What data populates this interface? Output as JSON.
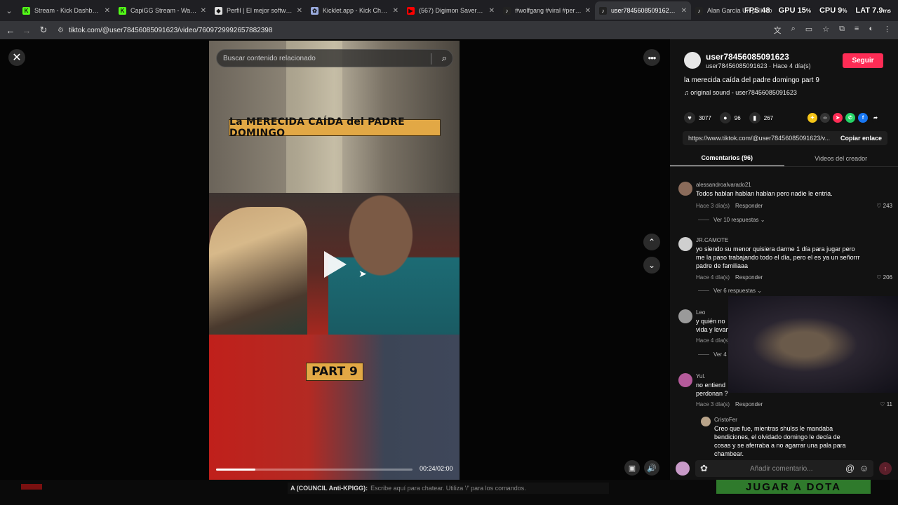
{
  "browser": {
    "tabs": [
      {
        "title": "Stream - Kick Dashboard",
        "fav": "K",
        "color": "#53fc18"
      },
      {
        "title": "CapiGG Stream - Watch Li",
        "fav": "K",
        "color": "#53fc18"
      },
      {
        "title": "Perfil | El mejor software p",
        "fav": "◆",
        "color": "#dddddd"
      },
      {
        "title": "Kicklet.app - Kick Chatbot",
        "fav": "✿",
        "color": "#9ad"
      },
      {
        "title": "(567) Digimon Savers - Bre",
        "fav": "▶",
        "color": "#ff0000"
      },
      {
        "title": "#wolfgang #viral #peru #",
        "fav": "♪",
        "color": "#222"
      },
      {
        "title": "user78456085091623 (@us",
        "fav": "♪",
        "color": "#222",
        "active": true
      },
      {
        "title": "Alan García Un político",
        "fav": "♪",
        "color": "#222"
      }
    ],
    "url": "tiktok.com/@user78456085091623/video/7609729992657882398"
  },
  "overlay": {
    "fps_label": "FPS",
    "fps_value": "48",
    "gpu_label": "GPU",
    "gpu_value": "15",
    "gpu_unit": "%",
    "cpu_label": "CPU",
    "cpu_value": "9",
    "cpu_unit": "%",
    "lat_label": "LAT",
    "lat_value": "7.9",
    "lat_unit": "ms"
  },
  "video": {
    "search_placeholder": "Buscar contenido relacionado",
    "caption_title": "La MERECIDA CAÍDA del PADRE DOMINGO",
    "caption_part": "PART 9",
    "time": "00:24/02:00",
    "progress": 0.2
  },
  "author": {
    "username": "user78456085091623",
    "subline": "user78456085091623 · Hace 4 día(s)",
    "follow_label": "Seguir",
    "description": "la merecida caída del padre domingo part 9",
    "sound": "original sound - user78456085091623"
  },
  "stats": {
    "likes": "3077",
    "comments": "96",
    "saves": "267"
  },
  "share": {
    "link": "https://www.tiktok.com/@user78456085091623/v...",
    "copy_label": "Copiar enlace",
    "icons": [
      {
        "name": "repost-icon",
        "glyph": "✦",
        "color": "#f5c518"
      },
      {
        "name": "embed-icon",
        "glyph": "‹›",
        "color": "#333"
      },
      {
        "name": "send-to-friends-icon",
        "glyph": "➤",
        "color": "#fe2c55"
      },
      {
        "name": "whatsapp-icon",
        "glyph": "✆",
        "color": "#25d366"
      },
      {
        "name": "facebook-icon",
        "glyph": "f",
        "color": "#1877f2"
      },
      {
        "name": "share-arrow-icon",
        "glyph": "➦",
        "color": "#121212"
      }
    ]
  },
  "panel_tabs": {
    "comments": "Comentarios (96)",
    "creator_videos": "Videos del creador"
  },
  "comments": [
    {
      "user": "alessandroalvarado21",
      "text": "Todos hablan hablan hablan pero nadie le entria.",
      "time": "Hace 3 día(s)",
      "reply": "Responder",
      "likes": "243",
      "more": "Ver 10 respuestas"
    },
    {
      "user": "JR.CAMOTE",
      "text": "yo siendo su menor quisiera darme 1 día para jugar pero me la paso trabajando todo el día, pero el es ya un señorrr padre de familiaaa",
      "time": "Hace 4 día(s)",
      "reply": "Responder",
      "likes": "206",
      "more": "Ver 6 respuestas"
    },
    {
      "user": "Leo",
      "text": "y quién no vida y levan",
      "time": "Hace 4 día(s)",
      "reply": "",
      "likes": "",
      "more": "Ver 4"
    },
    {
      "user": "Yul.",
      "text": "no entiend perdonan ?",
      "time": "Hace 3 día(s)",
      "reply": "Responder",
      "likes": "11",
      "more": ""
    },
    {
      "user": "CristoFer",
      "text": "Creo que fue, mientras shulss le mandaba bendiciones, el olvidado domingo le decía de cosas y se aferraba a no agarrar una pala para chambear.",
      "time": "",
      "reply": "",
      "likes": "",
      "more": ""
    }
  ],
  "comment_input": {
    "placeholder": "Añadir comentario..."
  },
  "stream_strip": {
    "chat_user": "A (COUNCIL Anti-KPIGG):",
    "chat_hint": "Escribe aquí para chatear. Utiliza '/' para los comandos.",
    "promo": "JUGAR A DOTA"
  }
}
